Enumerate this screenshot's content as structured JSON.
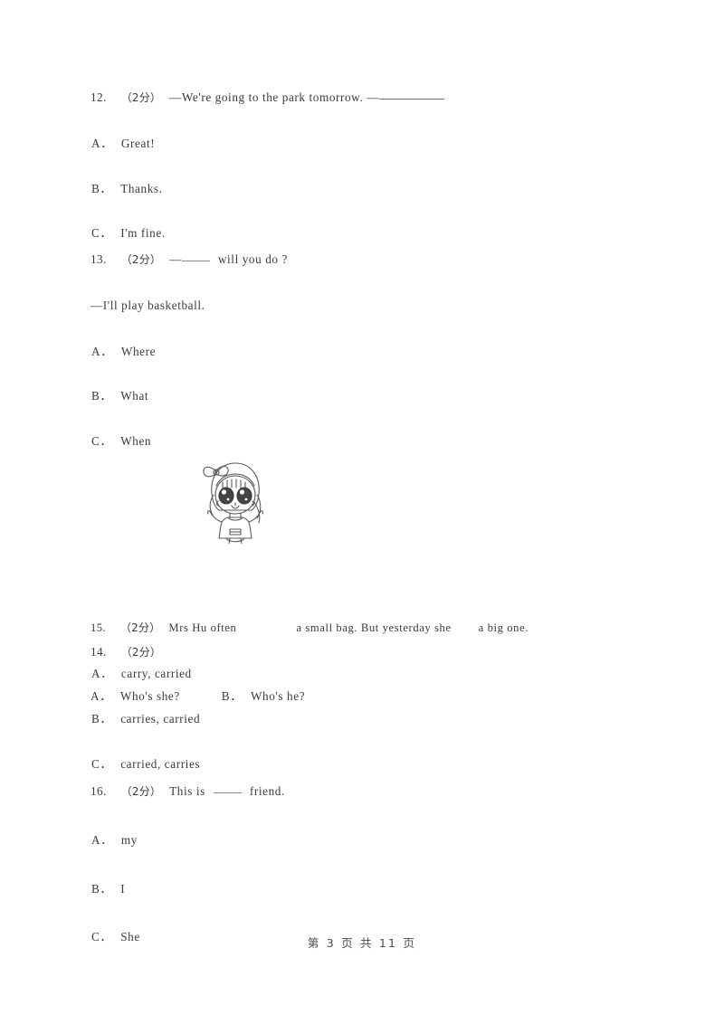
{
  "document": {
    "type": "exam-worksheet",
    "footer": "第 3 页 共 11 页",
    "page_number": "3",
    "total_pages": "11"
  },
  "questions": [
    {
      "number": "12.",
      "marks": "（2分）",
      "stem_before": "—We're going to the park tomorrow. —",
      "stem_after": "",
      "options": [
        {
          "letter": "A",
          "sep": "．",
          "text": "Great!"
        },
        {
          "letter": "B",
          "sep": "．",
          "text": "Thanks."
        },
        {
          "letter": "C",
          "sep": "．",
          "text": "I'm fine."
        }
      ]
    },
    {
      "number": "13.",
      "marks": "（2分）",
      "stem_before": "—",
      "stem_after": "will you do ?",
      "sub_line": "—I'll play basketball.",
      "options": [
        {
          "letter": "A",
          "sep": "．",
          "text": "Where"
        },
        {
          "letter": "B",
          "sep": "．",
          "text": "What"
        },
        {
          "letter": "C",
          "sep": "．",
          "text": "When"
        }
      ]
    },
    {
      "number": "14.",
      "marks": "（2分）",
      "stem_before": "",
      "stem_after": "",
      "illustration": "cartoon-girl-with-bow",
      "options_inline": [
        {
          "letter": "A",
          "sep": "．",
          "text": "Who's she?"
        },
        {
          "letter": "B",
          "sep": "．",
          "text": "Who's he?"
        }
      ]
    },
    {
      "number": "15.",
      "marks": "（2分）",
      "stem_part1": "Mrs Hu often",
      "stem_part2": "a small bag. But yesterday she",
      "stem_part3": "a big one.",
      "options": [
        {
          "letter": "A",
          "sep": "．",
          "text": "carry, carried"
        },
        {
          "letter": "B",
          "sep": "．",
          "text": "carries, carried"
        },
        {
          "letter": "C",
          "sep": "．",
          "text": "carried, carries"
        }
      ]
    },
    {
      "number": "16.",
      "marks": "（2分）",
      "stem_before": "This is",
      "stem_after": "friend.",
      "options": [
        {
          "letter": "A",
          "sep": "．",
          "text": "my"
        },
        {
          "letter": "B",
          "sep": "．",
          "text": "I"
        },
        {
          "letter": "C",
          "sep": "．",
          "text": "She"
        }
      ]
    }
  ],
  "colors": {
    "page_background": "#ffffff",
    "text": "#3a3a3a",
    "rule": "#6e6e6e",
    "illustration_stroke": "#5a5a5a"
  }
}
